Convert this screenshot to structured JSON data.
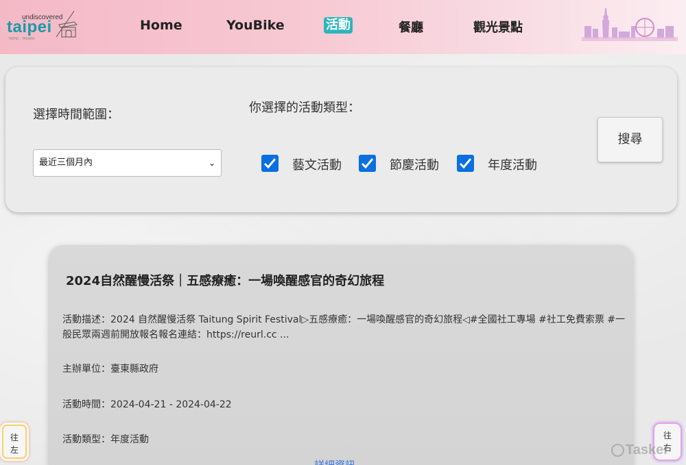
{
  "header": {
    "logo_small": "undiscovered",
    "logo_main": "taipei",
    "logo_tiny": "TAIPEI · TAIWAN",
    "nav": {
      "home": "Home",
      "youbike": "YouBike",
      "activity": "活動",
      "restaurant": "餐廳",
      "sights": "觀光景點"
    },
    "active_color": "#2ab5bd"
  },
  "filter": {
    "time_label": "選擇時間範圍：",
    "time_value": "最近三個月內",
    "type_label": "你選擇的活動類型：",
    "types": [
      {
        "label": "藝文活動",
        "checked": true
      },
      {
        "label": "節慶活動",
        "checked": true
      },
      {
        "label": "年度活動",
        "checked": true
      }
    ],
    "search_label": "搜尋",
    "checkbox_color": "#0a6fe0"
  },
  "card": {
    "title": "2024自然醒慢活祭｜五感療癒：一場喚醒感官的奇幻旅程",
    "description": "活動描述：2024 自然醒慢活祭 Taitung Spirit Festival▷五感療癒：一場喚醒感官的奇幻旅程◁#全國社工專場 #社工免費索票 #一般民眾兩週前開放報名報名連結：https://reurl.cc ...",
    "organizer": "主辦單位：臺東縣政府",
    "time": "活動時間：2024-04-21 - 2024-04-22",
    "type": "活動類型：年度活動",
    "detail_link": "詳細資訊"
  },
  "side_buttons": {
    "left": [
      "往",
      "左"
    ],
    "right": [
      "往",
      "右"
    ]
  },
  "watermark": "Tasker"
}
